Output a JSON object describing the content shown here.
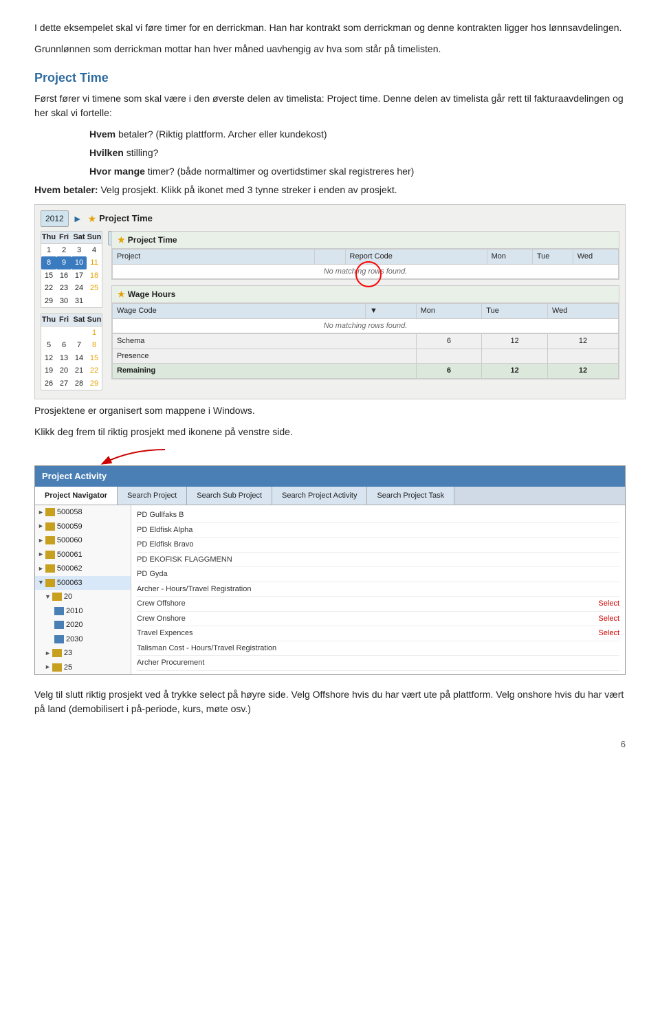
{
  "paragraphs": {
    "p1": "I dette eksempelet skal vi føre timer for en derrickman. Han har kontrakt som derrickman og denne kontrakten ligger hos lønnsavdelingen.",
    "p2": "Grunnlønnen som derrickman mottar han hver måned uavhengig av hva som står på timelisten.",
    "section_title": "Project Time",
    "p3": "Først fører vi timene som skal være i den øverste delen av timelista: Project time. Denne delen av timelista går rett til fakturaavdelingen og her skal vi fortelle:",
    "indent1_label": "Hvem",
    "indent1_text": " betaler? (Riktig plattform. Archer eller kundekost)",
    "indent2_label": "Hvilken",
    "indent2_text": " stilling?",
    "indent3_label": "Hvor mange",
    "indent3_text": " timer? (både normaltimer og overtidstimer skal registreres her)",
    "p4_label": "Hvem betaler:",
    "p4_text": " Velg prosjekt. Klikk på ikonet med 3 tynne streker i enden av prosjekt.",
    "p5": "Prosjektene er organisert som mappene i Windows.",
    "p6": "Klikk deg frem til riktig prosjekt med ikonene på venstre side.",
    "p7": "Velg til slutt riktig prosjekt ved å trykke select på høyre side. Velg Offshore hvis du har vært ute på plattform. Velg onshore hvis du har vært på land (demobilisert i på-periode, kurs, møte osv.)",
    "page_number": "6"
  },
  "project_time_screenshot": {
    "year": "2012",
    "title": "Project Time",
    "cal1_header": [
      "Thu",
      "Fri",
      "Sat",
      "Sun"
    ],
    "cal1_rows": [
      [
        "1",
        "2",
        "3",
        "4"
      ],
      [
        "8",
        "9",
        "10",
        "11"
      ],
      [
        "15",
        "16",
        "17",
        "18"
      ],
      [
        "22",
        "23",
        "24",
        "25"
      ],
      [
        "29",
        "30",
        "31",
        ""
      ]
    ],
    "cal1_highlight": [
      "8",
      "9",
      "10"
    ],
    "cal1_orange": [
      "11",
      "18",
      "25"
    ],
    "cal2_year": "2012",
    "cal2_header": [
      "Thu",
      "Fri",
      "Sat",
      "Sun"
    ],
    "cal2_rows": [
      [
        "",
        "",
        "",
        "1"
      ],
      [
        "5",
        "6",
        "7",
        "8"
      ],
      [
        "12",
        "13",
        "14",
        "15"
      ],
      [
        "19",
        "20",
        "21",
        "22"
      ],
      [
        "26",
        "27",
        "28",
        "29"
      ]
    ],
    "cal2_orange": [
      "1",
      "8",
      "15",
      "22",
      "29"
    ],
    "section1_title": "Project Time",
    "section1_cols": [
      "Project",
      "",
      "Report Code",
      "Mon",
      "Tue",
      "Wed"
    ],
    "section1_no_rows": "No matching rows found.",
    "section2_title": "Wage Hours",
    "section2_cols": [
      "Wage Code",
      "",
      "Mon",
      "Tue",
      "Wed"
    ],
    "section2_no_rows": "No matching rows found.",
    "bottom_rows": [
      {
        "label": "Schema",
        "mon": "6",
        "tue": "12",
        "wed": "12"
      },
      {
        "label": "Presence",
        "mon": "",
        "tue": "",
        "wed": ""
      },
      {
        "label": "Remaining",
        "mon": "6",
        "tue": "12",
        "wed": "12",
        "bold": true
      }
    ]
  },
  "project_activity_screenshot": {
    "title": "Project Activity",
    "tabs": [
      "Project Navigator",
      "Search Project",
      "Search Sub Project",
      "Search Project Activity",
      "Search Project Task"
    ],
    "active_tab": "Project Navigator",
    "tree_items": [
      {
        "id": "500058",
        "level": 0,
        "type": "folder",
        "has_expand": true
      },
      {
        "id": "500059",
        "level": 0,
        "type": "folder",
        "has_expand": true
      },
      {
        "id": "500060",
        "level": 0,
        "type": "folder",
        "has_expand": true
      },
      {
        "id": "500061",
        "level": 0,
        "type": "folder",
        "has_expand": true
      },
      {
        "id": "500062",
        "level": 0,
        "type": "folder",
        "has_expand": true
      },
      {
        "id": "500063",
        "level": 0,
        "type": "folder",
        "has_expand": true,
        "open": true
      },
      {
        "id": "20",
        "level": 1,
        "type": "folder",
        "has_expand": true,
        "open": true
      },
      {
        "id": "2010",
        "level": 2,
        "type": "blue"
      },
      {
        "id": "2020",
        "level": 2,
        "type": "blue"
      },
      {
        "id": "2030",
        "level": 2,
        "type": "blue"
      },
      {
        "id": "23",
        "level": 1,
        "type": "folder",
        "has_expand": true
      },
      {
        "id": "25",
        "level": 1,
        "type": "folder",
        "has_expand": true
      }
    ],
    "right_rows": [
      {
        "name": "PD Gullfaks B",
        "select": false
      },
      {
        "name": "PD Eldfisk Alpha",
        "select": false
      },
      {
        "name": "PD Eldfisk Bravo",
        "select": false
      },
      {
        "name": "PD EKOFISK FLAGGMENN",
        "select": false
      },
      {
        "name": "PD Gyda",
        "select": false
      },
      {
        "name": "Archer - Hours/Travel Registration",
        "select": false
      },
      {
        "name": "Crew Offshore",
        "select": true
      },
      {
        "name": "Crew Onshore",
        "select": true
      },
      {
        "name": "Travel Expences",
        "select": true
      },
      {
        "name": "Talisman Cost - Hours/Travel Registration",
        "select": false
      },
      {
        "name": "Archer Procurement",
        "select": false
      }
    ],
    "select_label": "Select"
  },
  "colors": {
    "section_title": "#2e6b9e",
    "pa_title_bar": "#4a7fb5",
    "red": "#cc0000",
    "highlight_blue": "#3a7abf"
  }
}
